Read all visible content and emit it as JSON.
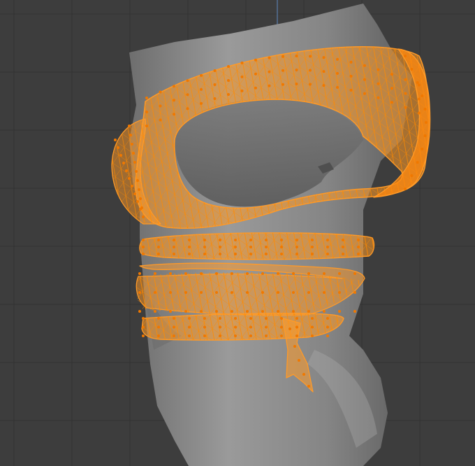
{
  "viewport": {
    "background_color": "#3d3d3d",
    "grid_color": "#333333",
    "axis_color": "#5b7fae",
    "mesh_body_color": "#8a8a8a",
    "selection_color": "#ff9a28",
    "vertex_color": "#f07800",
    "edit_mode": "vertex-select"
  }
}
